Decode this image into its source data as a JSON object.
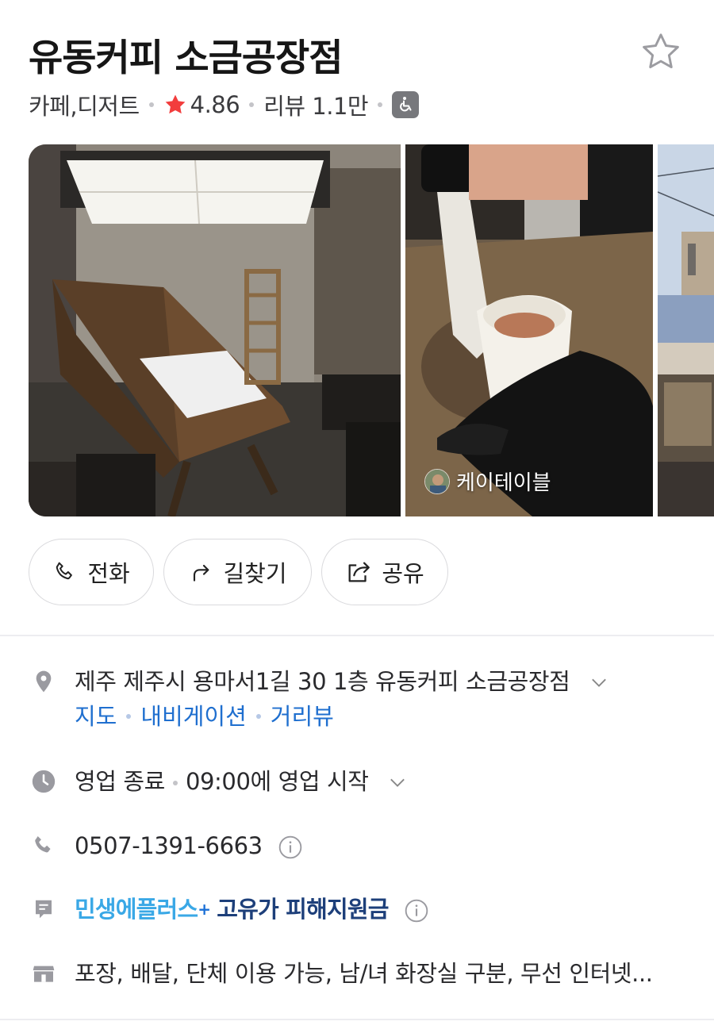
{
  "place": {
    "name": "유동커피 소금공장점",
    "category": "카페,디저트",
    "rating": "4.86",
    "reviews": "리뷰 1.1만",
    "icons": {
      "favorite": "star-outline-icon",
      "rating": "star-filled-icon",
      "accessibility": "wheelchair-icon"
    }
  },
  "photos": [
    {
      "name": "interior-photo"
    },
    {
      "name": "drink-photo",
      "author": "케이테이블"
    },
    {
      "name": "exterior-photo"
    }
  ],
  "actions": {
    "call": "전화",
    "route": "길찾기",
    "share": "공유"
  },
  "address": {
    "text": "제주 제주시 용마서1길 30 1층 유동커피 소금공장점",
    "links": {
      "map": "지도",
      "navigation": "내비게이션",
      "street_view": "거리뷰"
    }
  },
  "hours": {
    "status": "영업 종료",
    "next": "09:00에 영업 시작"
  },
  "phone": "0507-1391-6663",
  "promo": {
    "part1": "민생에플러스",
    "plus": "+",
    "part2": "고유가 피해지원금"
  },
  "amenities": "포장, 배달, 단체 이용 가능, 남/녀 화장실 구분, 무선 인터넷...",
  "colors": {
    "rating_star": "#f23d3d",
    "link": "#1f6fcf",
    "icon_gray": "#9a9aa0"
  }
}
